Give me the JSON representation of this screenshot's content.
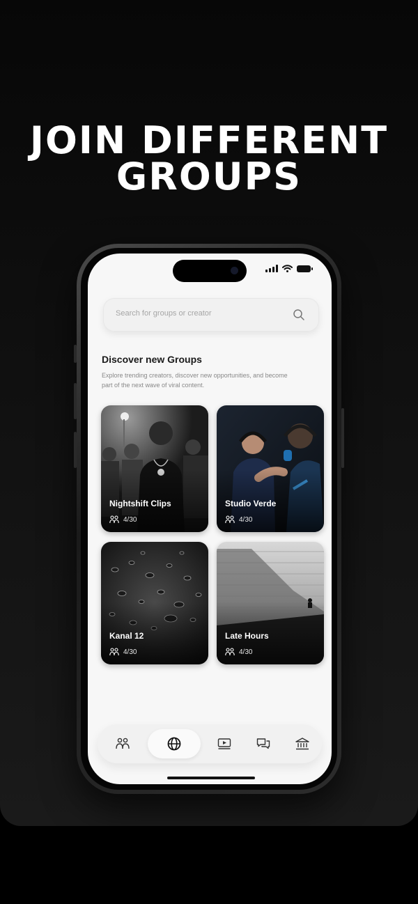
{
  "headline": {
    "line1": "JOIN DIFFERENT",
    "line2": "GROUPS"
  },
  "search": {
    "placeholder": "Search for groups or creator",
    "icon": "search-icon"
  },
  "discover": {
    "title": "Discover new Groups",
    "description": "Explore trending creators, discover new opportunities, and become part of the next wave of viral content."
  },
  "groups": [
    {
      "name": "Nightshift Clips",
      "members": "4/30"
    },
    {
      "name": "Studio Verde",
      "members": "4/30"
    },
    {
      "name": "Kanal 12",
      "members": "4/30"
    },
    {
      "name": "Late Hours",
      "members": "4/30"
    }
  ],
  "nav": {
    "items": [
      "groups-icon",
      "globe-icon",
      "video-icon",
      "chat-icon",
      "bank-icon"
    ],
    "active": "globe-icon"
  },
  "colors": {
    "screen": "#f7f7f7",
    "background": "#000000",
    "accent_text": "#1a1a1a"
  }
}
